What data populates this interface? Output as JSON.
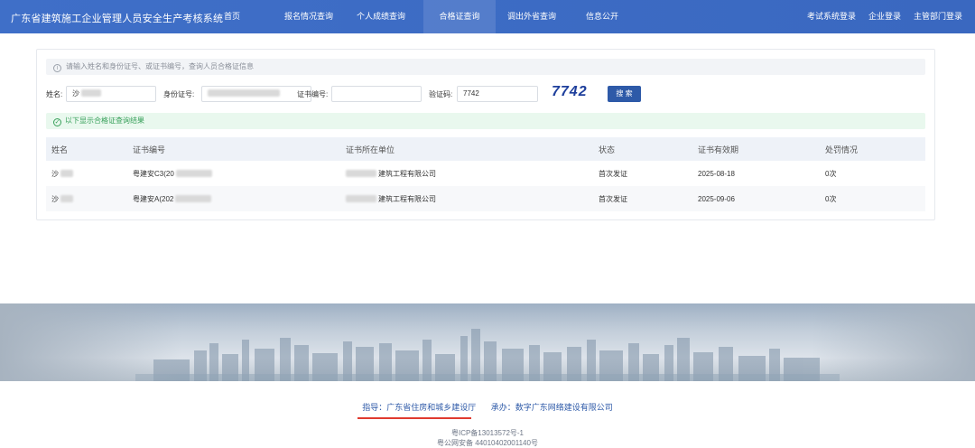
{
  "app": {
    "title": "广东省建筑施工企业管理人员安全生产考核系统"
  },
  "nav": {
    "items": [
      "首页",
      "报名情况查询",
      "个人成绩查询",
      "合格证查询",
      "调出外省查询",
      "信息公开"
    ],
    "active_index": 3,
    "right": [
      "考试系统登录",
      "企业登录",
      "主管部门登录"
    ]
  },
  "search": {
    "tip": "请输入姓名和身份证号、或证书编号，查询人员合格证信息",
    "name_label": "姓名:",
    "name_value": "沙",
    "id_label": "身份证号:",
    "cert_label": "证书编号:",
    "cert_value": "",
    "captcha_label": "验证码:",
    "captcha_value": "7742",
    "captcha_image_text": "7742",
    "search_button": "搜 索"
  },
  "result": {
    "tip": "以下显示合格证查询结果",
    "columns": [
      "姓名",
      "证书编号",
      "证书所在单位",
      "状态",
      "证书有效期",
      "处罚情况"
    ],
    "rows": [
      {
        "name": "沙",
        "cert_no": "粤建安C3(20",
        "company": "建筑工程有限公司",
        "status": "首次发证",
        "valid": "2025-08-18",
        "penalty": "0次"
      },
      {
        "name": "沙",
        "cert_no": "粤建安A(202",
        "company": "建筑工程有限公司",
        "status": "首次发证",
        "valid": "2025-09-06",
        "penalty": "0次"
      }
    ]
  },
  "footer": {
    "guide": "指导：广东省住房和城乡建设厅",
    "organizer": "承办：数字广东网络建设有限公司",
    "icp": "粤ICP备13013572号-1",
    "police": "粤公网安备 44010402001140号"
  },
  "colors": {
    "nav_bg": "#3f6fc8",
    "primary_button": "#2e5aa8",
    "success_bg": "#e9f8ee",
    "success_text": "#38a05a",
    "underline_red": "#e03a2f"
  }
}
